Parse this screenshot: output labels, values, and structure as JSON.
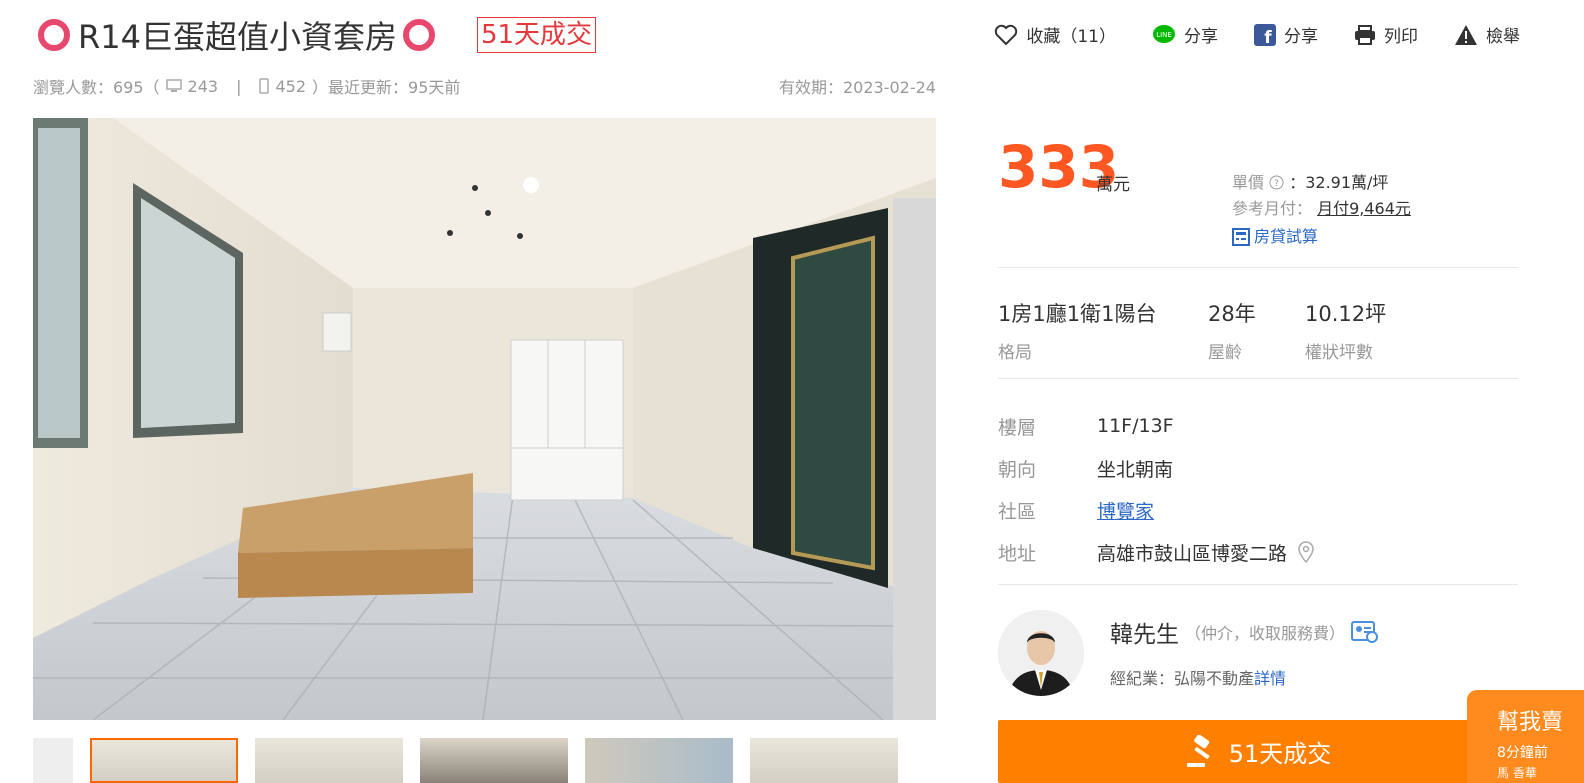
{
  "listing": {
    "title": "R14巨蛋超值小資套房",
    "sold_badge": "51天成交"
  },
  "actions": {
    "favorite_label": "收藏（11）",
    "line_share_label": "分享",
    "fb_share_label": "分享",
    "print_label": "列印",
    "report_label": "檢舉"
  },
  "stats": {
    "views": "瀏覽人數：695（",
    "desktop": "243",
    "separator": "|",
    "mobile": "452",
    "updated": "）最近更新：95天前",
    "valid_until": "有效期：2023-02-24"
  },
  "price": {
    "amount": "333",
    "unit": "萬元",
    "unit_price_label": "單價",
    "unit_price_value": "：32.91萬/坪",
    "monthly_label": "參考月付：",
    "monthly_value": "月付9,464元",
    "loan_calc_label": "房貸試算"
  },
  "specs": [
    {
      "value": "1房1廳1衛1陽台",
      "key": "格局"
    },
    {
      "value": "28年",
      "key": "屋齡"
    },
    {
      "value": "10.12坪",
      "key": "權狀坪數"
    }
  ],
  "details": {
    "floor_key": "樓層",
    "floor_value": "11F/13F",
    "orientation_key": "朝向",
    "orientation_value": "坐北朝南",
    "community_key": "社區",
    "community_value": "博覽家",
    "address_key": "地址",
    "address_value": "高雄市鼓山區博愛二路"
  },
  "agent": {
    "name": "韓先生",
    "role": "（仲介，收取服務費）",
    "company": "經紀業：弘陽不動產",
    "details_link": "詳情"
  },
  "sold_button": "51天成交",
  "float_tab": {
    "title": "幫我賣",
    "time": "8分鐘前",
    "text": "馬 香華"
  },
  "colors": {
    "price": "#ff5722",
    "sold_button": "#ff8000",
    "link": "#2b68c6",
    "badge": "#e4393c"
  }
}
